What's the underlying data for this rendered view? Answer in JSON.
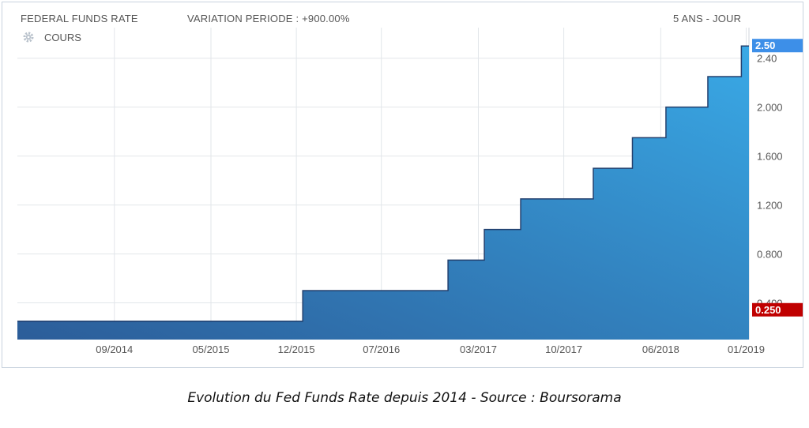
{
  "header": {
    "title": "FEDERAL FUNDS RATE",
    "variation": "VARIATION PERIODE : +900.00%",
    "period": "5 ANS - JOUR"
  },
  "legend": {
    "label": "COURS",
    "icon": "gear-icon"
  },
  "caption": "Evolution du Fed Funds Rate depuis 2014 - Source : Boursorama",
  "colors": {
    "area_top": "#39a9e6",
    "area_bottom": "#2c5d99",
    "line": "#23406e",
    "last_badge": "#3d8fe8",
    "min_badge": "#c00000",
    "grid": "#e2e6ea"
  },
  "chart_data": {
    "type": "area",
    "step": true,
    "x": [
      "2014-01-01",
      "2015-12-17",
      "2016-12-15",
      "2017-03-16",
      "2017-06-15",
      "2017-12-14",
      "2018-03-22",
      "2018-06-14",
      "2018-09-27",
      "2018-12-20",
      "2019-01-04"
    ],
    "values": [
      0.25,
      0.5,
      0.75,
      1.0,
      1.25,
      1.5,
      1.75,
      2.0,
      2.25,
      2.5,
      2.5
    ],
    "xticks": [
      "09/2014",
      "05/2015",
      "12/2015",
      "07/2016",
      "03/2017",
      "10/2017",
      "06/2018",
      "01/2019"
    ],
    "xtick_dates": [
      "2014-09-01",
      "2015-05-01",
      "2015-12-01",
      "2016-07-01",
      "2017-03-01",
      "2017-10-01",
      "2018-06-01",
      "2019-01-01"
    ],
    "yticks": [
      "0.400",
      "0.800",
      "1.200",
      "1.600",
      "2.000",
      "2.40"
    ],
    "ytick_values": [
      0.4,
      0.8,
      1.2,
      1.6,
      2.0,
      2.4
    ],
    "ylim": [
      0.1,
      2.65
    ],
    "last_value_label": "2.50",
    "min_value_label": "0.250",
    "grid": true
  }
}
